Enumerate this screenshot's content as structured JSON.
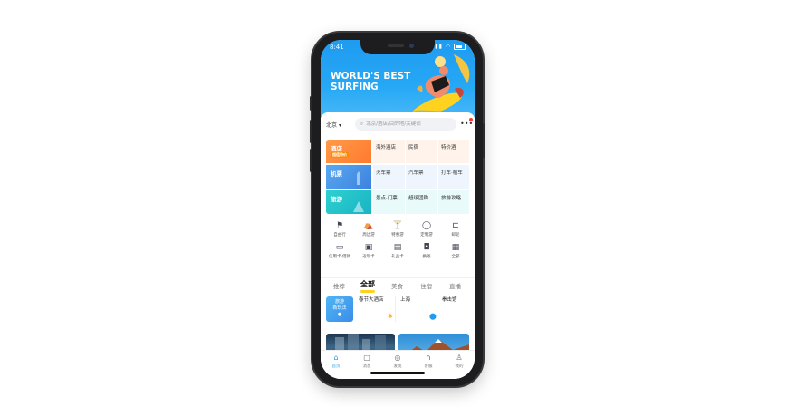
{
  "status_bar": {
    "time": "8:41"
  },
  "banner": {
    "headline_line1": "WORLD'S BEST",
    "headline_line2": "SURFING"
  },
  "search_bar": {
    "city": "北京",
    "placeholder": "北京/酒店/目的地/关键词",
    "more": "•••"
  },
  "services": {
    "hotel": {
      "label": "酒店",
      "badge": "超值特价",
      "items": [
        "海外酒店",
        "民宿",
        "特价酒"
      ]
    },
    "flight": {
      "label": "机票",
      "items": [
        "火车票",
        "汽车票",
        "打车·租车"
      ]
    },
    "travel": {
      "label": "旅游",
      "items": [
        "景点·门票",
        "超级团购",
        "旅游攻略"
      ]
    }
  },
  "quick_icons": [
    {
      "icon": "flag-icon",
      "label": "自由行"
    },
    {
      "icon": "tent-icon",
      "label": "周边游"
    },
    {
      "icon": "cocktail-icon",
      "label": "特惠游"
    },
    {
      "icon": "balloon-icon",
      "label": "定制游"
    },
    {
      "icon": "ticket-icon",
      "label": "邮轮"
    },
    {
      "icon": "card-icon",
      "label": "信用卡·借款"
    },
    {
      "icon": "wallet-icon",
      "label": "返现卡"
    },
    {
      "icon": "gift-icon",
      "label": "礼品卡"
    },
    {
      "icon": "bag-icon",
      "label": "换钱"
    },
    {
      "icon": "grid-icon",
      "label": "全部"
    }
  ],
  "feed_tabs": [
    {
      "label": "推荐"
    },
    {
      "label": "全部"
    },
    {
      "label": "美食"
    },
    {
      "label": "住宿"
    },
    {
      "label": "直播"
    }
  ],
  "recommendations": {
    "hot": {
      "line1": "旅游",
      "line2": "新玩法"
    },
    "items": [
      {
        "title": "春节大酒店",
        "sub": ""
      },
      {
        "title": "上海",
        "sub": ""
      },
      {
        "title": "拳击馆",
        "sub": ""
      }
    ]
  },
  "bottom_nav": [
    {
      "icon": "home-icon",
      "label": "首页"
    },
    {
      "icon": "message-icon",
      "label": "消息"
    },
    {
      "icon": "compass-icon",
      "label": "发现"
    },
    {
      "icon": "headset-icon",
      "label": "客服"
    },
    {
      "icon": "user-icon",
      "label": "我的"
    }
  ],
  "colors": {
    "brand_blue": "#1f9bf0",
    "hotel_orange": "#ff8a3d",
    "flight_blue": "#4a90e2",
    "travel_teal": "#1fc0c8",
    "accent_yellow": "#ffd21f"
  }
}
